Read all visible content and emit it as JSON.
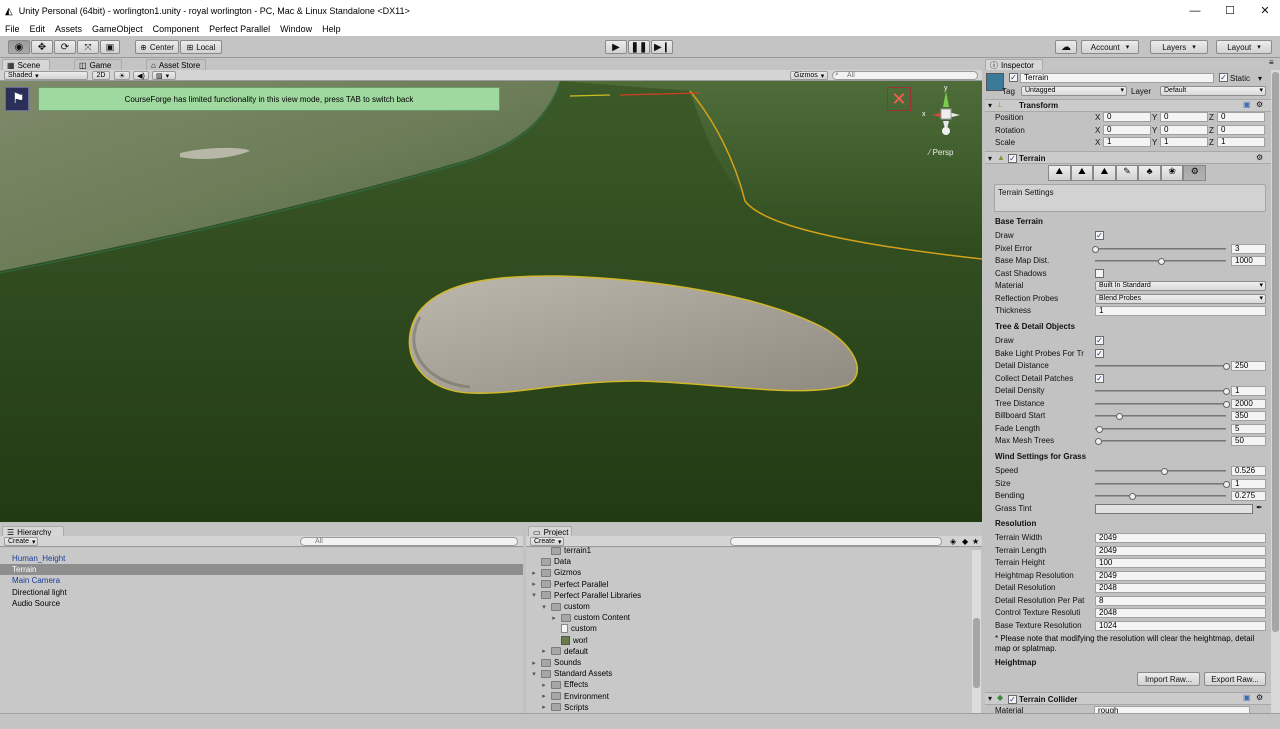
{
  "window": {
    "title": "Unity Personal (64bit) - worlington1.unity - royal worlington - PC, Mac & Linux Standalone <DX11>",
    "controls": [
      "—",
      "☐",
      "✕"
    ]
  },
  "menu": [
    "File",
    "Edit",
    "Assets",
    "GameObject",
    "Component",
    "Perfect Parallel",
    "Window",
    "Help"
  ],
  "toolbar": {
    "pivot": "Center",
    "space": "Local",
    "account": "Account",
    "layers": "Layers",
    "layout": "Layout"
  },
  "scene_tabs": [
    "Scene",
    "Game",
    "Asset Store"
  ],
  "scene_controls": {
    "shading": "Shaded",
    "mode2d": "2D",
    "gizmos": "Gizmos",
    "search_placeholder": "All"
  },
  "scene": {
    "banner": "CourseForge has limited functionality in this view mode, press TAB to switch back",
    "projection": "Persp",
    "gizmo_y": "y",
    "gizmo_x": "x",
    "accent": "#9fd99f",
    "close_color": "#c33b33"
  },
  "hierarchy": {
    "tab": "Hierarchy",
    "create": "Create",
    "search_placeholder": "All",
    "items": [
      {
        "label": "Human_Height",
        "color": "#1a3c9a"
      },
      {
        "label": "Terrain",
        "color": "#ffffff",
        "selected": true
      },
      {
        "label": "Main Camera",
        "color": "#1a3c9a"
      },
      {
        "label": "Directional light",
        "color": "#000000"
      },
      {
        "label": "Audio Source",
        "color": "#000000"
      }
    ]
  },
  "project": {
    "tab": "Project",
    "create": "Create",
    "items": [
      {
        "label": "terrain1",
        "depth": 1,
        "type": "folder"
      },
      {
        "label": "Data",
        "depth": 0,
        "type": "folder"
      },
      {
        "label": "Gizmos",
        "depth": 0,
        "type": "folder",
        "arrow": "▸"
      },
      {
        "label": "Perfect Parallel",
        "depth": 0,
        "type": "folder",
        "arrow": "▸"
      },
      {
        "label": "Perfect Parallel Libraries",
        "depth": 0,
        "type": "folder",
        "arrow": "▾"
      },
      {
        "label": "custom",
        "depth": 1,
        "type": "folder",
        "arrow": "▾"
      },
      {
        "label": "custom Content",
        "depth": 2,
        "type": "folder",
        "arrow": "▸"
      },
      {
        "label": "custom",
        "depth": 2,
        "type": "file"
      },
      {
        "label": "worl",
        "depth": 2,
        "type": "asset"
      },
      {
        "label": "default",
        "depth": 1,
        "type": "folder",
        "arrow": "▸"
      },
      {
        "label": "Sounds",
        "depth": 0,
        "type": "folder",
        "arrow": "▸"
      },
      {
        "label": "Standard Assets",
        "depth": 0,
        "type": "folder",
        "arrow": "▾"
      },
      {
        "label": "Effects",
        "depth": 1,
        "type": "folder",
        "arrow": "▸"
      },
      {
        "label": "Environment",
        "depth": 1,
        "type": "folder",
        "arrow": "▸"
      },
      {
        "label": "Scripts",
        "depth": 1,
        "type": "folder",
        "arrow": "▸"
      }
    ]
  },
  "inspector": {
    "tab": "Inspector",
    "object_name": "Terrain",
    "static": "Static",
    "tag_label": "Tag",
    "tag": "Untagged",
    "layer_label": "Layer",
    "layer": "Default",
    "transform": {
      "title": "Transform",
      "rows": [
        {
          "label": "Position",
          "x": "0",
          "y": "0",
          "z": "0"
        },
        {
          "label": "Rotation",
          "x": "0",
          "y": "0",
          "z": "0"
        },
        {
          "label": "Scale",
          "x": "1",
          "y": "1",
          "z": "1"
        }
      ]
    },
    "terrain": {
      "title": "Terrain",
      "settings_box": "Terrain Settings",
      "base_header": "Base Terrain",
      "draw": "Draw",
      "pixel_error": {
        "label": "Pixel Error",
        "value": "3",
        "frac": 0.0
      },
      "base_map_dist": {
        "label": "Base Map Dist.",
        "value": "1000",
        "frac": 0.5
      },
      "cast_shadows": "Cast Shadows",
      "material": {
        "label": "Material",
        "value": "Built In Standard"
      },
      "reflection": {
        "label": "Reflection Probes",
        "value": "Blend Probes"
      },
      "thickness": {
        "label": "Thickness",
        "value": "1"
      },
      "tree_header": "Tree & Detail Objects",
      "tree_draw": "Draw",
      "bake_light": "Bake Light Probes For Tr",
      "detail_distance": {
        "label": "Detail Distance",
        "value": "250",
        "frac": 1.0
      },
      "collect_patches": "Collect Detail Patches",
      "detail_density": {
        "label": "Detail Density",
        "value": "1",
        "frac": 1.0
      },
      "tree_distance": {
        "label": "Tree Distance",
        "value": "2000",
        "frac": 1.0
      },
      "billboard_start": {
        "label": "Billboard Start",
        "value": "350",
        "frac": 0.18
      },
      "fade_length": {
        "label": "Fade Length",
        "value": "5",
        "frac": 0.03
      },
      "max_mesh_trees": {
        "label": "Max Mesh Trees",
        "value": "50",
        "frac": 0.02
      },
      "wind_header": "Wind Settings for Grass",
      "speed": {
        "label": "Speed",
        "value": "0.526",
        "frac": 0.53
      },
      "size": {
        "label": "Size",
        "value": "1",
        "frac": 1.0
      },
      "bending": {
        "label": "Bending",
        "value": "0.275",
        "frac": 0.28
      },
      "grass_tint": "Grass Tint",
      "res_header": "Resolution",
      "res_rows": [
        {
          "label": "Terrain Width",
          "value": "2049"
        },
        {
          "label": "Terrain Length",
          "value": "2049"
        },
        {
          "label": "Terrain Height",
          "value": "100"
        },
        {
          "label": "Heightmap Resolution",
          "value": "2049"
        },
        {
          "label": "Detail Resolution",
          "value": "2048"
        },
        {
          "label": "Detail Resolution Per Pat",
          "value": "8"
        },
        {
          "label": "Control Texture Resoluti",
          "value": "2048"
        },
        {
          "label": "Base Texture Resolution",
          "value": "1024"
        }
      ],
      "note": "* Please note that modifying the resolution will clear the heightmap, detail map or splatmap.",
      "heightmap_header": "Heightmap",
      "import_raw": "Import Raw...",
      "export_raw": "Export Raw..."
    },
    "collider": {
      "title": "Terrain Collider",
      "material_label": "Material",
      "material_value": "rough"
    }
  }
}
